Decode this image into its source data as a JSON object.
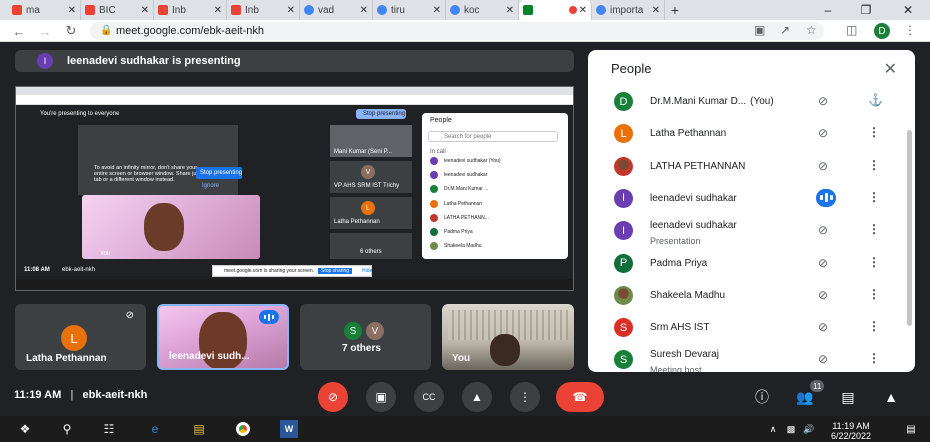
{
  "browser": {
    "tabs": [
      {
        "label": "ma",
        "favicon": "gmail-icon",
        "color": "#ea4335"
      },
      {
        "label": "BIC",
        "favicon": "gmail-icon",
        "color": "#ea4335"
      },
      {
        "label": "Inb",
        "favicon": "gmail-icon",
        "color": "#ea4335"
      },
      {
        "label": "Inb",
        "favicon": "gmail-icon",
        "color": "#ea4335"
      },
      {
        "label": "vad",
        "favicon": "google-icon",
        "color": "#4285f4"
      },
      {
        "label": "tiru",
        "favicon": "google-icon",
        "color": "#4285f4"
      },
      {
        "label": "koc",
        "favicon": "google-icon",
        "color": "#4285f4"
      },
      {
        "label": "",
        "favicon": "meet-icon",
        "color": "#00832d"
      },
      {
        "label": "importa",
        "favicon": "google-icon",
        "color": "#4285f4"
      }
    ],
    "url": "meet.google.com/ebk-aeit-nkh",
    "profile_initial": "D"
  },
  "meet": {
    "presenter_banner": "leenadevi sudhakar is presenting",
    "presenter_initial": "I",
    "meeting_time": "11:19 AM",
    "meeting_code": "ebk-aeit-nkh",
    "participant_count": "11"
  },
  "shared_screen": {
    "presenting_text": "You're presenting to everyone",
    "stop_presenting": "Stop presenting",
    "mirror_warning": "To avoid an infinity mirror, don't share your entire screen or browser window. Share just a tab or a different window instead.",
    "stop_presenting_btn": "Stop presenting",
    "ignore": "Ignore",
    "people_title": "People",
    "search_placeholder": "Search for people",
    "in_call": "In call",
    "mini_people": [
      "leenadevi sudhakar (You)",
      "leenadevi sudhakar",
      "Dr.M.Mani Kumar ...",
      "Latha Pethannan",
      "LATHA PETHANN...",
      "Padma Priya",
      "Shakeela Madhu"
    ],
    "mini_tiles": [
      "Mani Kumar (Seni P...",
      "VP AHS SRM IST Trichy",
      "Latha Pethannan",
      "6 others",
      "You"
    ],
    "mini_time": "11:08 AM",
    "mini_code": "ebk-aeit-nkh",
    "sharing_bar": "meet.google.com is sharing your screen.",
    "sharing_stop": "Stop sharing",
    "sharing_hide": "Hide"
  },
  "tiles": [
    {
      "name": "Latha Pethannan",
      "initial": "L",
      "color": "#e8710a"
    },
    {
      "name": "leenadevi sudh...",
      "type": "video"
    },
    {
      "name": "7 others",
      "initials": [
        "S",
        "V"
      ],
      "colors": [
        "#188038",
        "#8d6e63"
      ]
    },
    {
      "name": "You",
      "type": "video"
    }
  ],
  "people_panel": {
    "title": "People",
    "participants": [
      {
        "name": "Dr.M.Mani Kumar D...",
        "suffix": "(You)",
        "initial": "D",
        "color": "#188038",
        "mic": "muted",
        "action": "pin"
      },
      {
        "name": "Latha Pethannan",
        "initial": "L",
        "color": "#e8710a",
        "mic": "muted",
        "action": "more"
      },
      {
        "name": "LATHA PETHANNAN",
        "initial": "",
        "color": "#c0392b",
        "photo": true,
        "mic": "muted",
        "action": "more"
      },
      {
        "name": "leenadevi sudhakar",
        "initial": "I",
        "color": "#6a3eb2",
        "mic": "speaking",
        "action": "more"
      },
      {
        "name": "leenadevi sudhakar",
        "sub": "Presentation",
        "initial": "I",
        "color": "#6a3eb2",
        "mic": "presenting-off",
        "action": "more"
      },
      {
        "name": "Padma Priya",
        "initial": "P",
        "color": "#0f6e3a",
        "mic": "muted",
        "action": "more"
      },
      {
        "name": "Shakeela Madhu",
        "initial": "",
        "color": "#6d8b4a",
        "photo": true,
        "mic": "muted",
        "action": "more"
      },
      {
        "name": "Srm AHS IST",
        "initial": "S",
        "color": "#d93025",
        "mic": "muted",
        "action": "more"
      },
      {
        "name": "Suresh Devaraj",
        "sub": "Meeting host",
        "initial": "S",
        "color": "#188038",
        "mic": "muted",
        "action": "more"
      }
    ]
  },
  "taskbar": {
    "time": "11:19 AM",
    "date": "6/22/2022"
  }
}
